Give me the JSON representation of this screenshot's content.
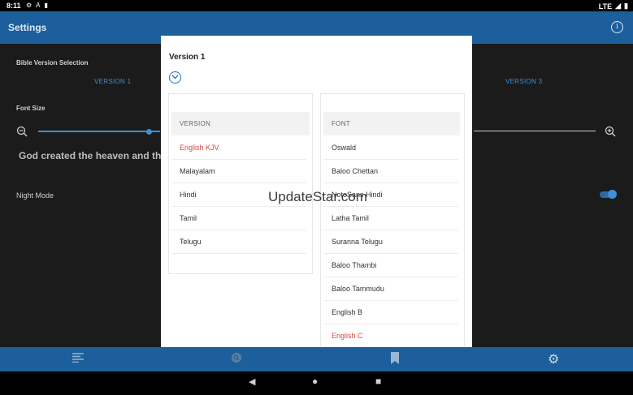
{
  "status": {
    "time": "8:11",
    "network": "LTE"
  },
  "appbar": {
    "title": "Settings"
  },
  "settings": {
    "bible_version_label": "Bible Version Selection",
    "version1": "VERSION 1",
    "version3": "VERSION 3",
    "font_size_label": "Font Size",
    "font_size_level": 0.4,
    "sample_text": "God created the heaven and the e",
    "night_mode_label": "Night Mode",
    "night_mode_on": true
  },
  "dialog": {
    "title": "Version 1",
    "version_header": "VERSION",
    "versions": [
      "English KJV",
      "Malayalam",
      "Hindi",
      "Tamil",
      "Telugu"
    ],
    "selected_version": "English KJV",
    "font_header": "FONT",
    "fonts": [
      "Oswald",
      "Baloo Chettan",
      "NotoSans Hindi",
      "Latha Tamil",
      "Suranna Telugu",
      "Baloo Thambi",
      "Baloo Tammudu",
      "English B",
      "English C"
    ],
    "selected_font": "English C"
  },
  "watermark": "UpdateStar.com",
  "colors": {
    "primary": "#1c5f9c",
    "accent": "#3d8fd6",
    "selected": "#e0463c"
  },
  "icons": {
    "info": "info-icon",
    "chevron": "chevron-down-circle-icon",
    "nav": [
      "list-icon",
      "search-icon",
      "bookmark-icon",
      "gear-icon"
    ]
  }
}
